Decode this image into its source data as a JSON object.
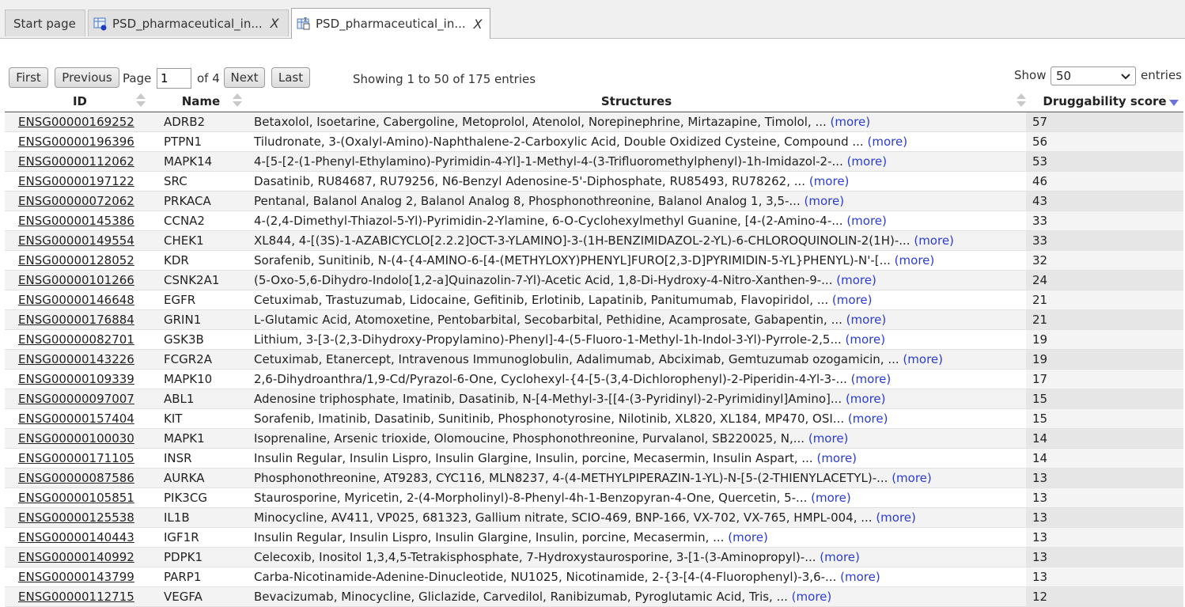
{
  "tabs": [
    {
      "label": "Start page"
    },
    {
      "label": "PSD_pharmaceutical_in...",
      "close": "X"
    },
    {
      "label": "PSD_pharmaceutical_in...",
      "close": "X"
    }
  ],
  "pager": {
    "first": "First",
    "previous": "Previous",
    "page_label": "Page",
    "page_value": "1",
    "of_label": "of 4",
    "next": "Next",
    "last": "Last",
    "info": "Showing 1 to 50 of 175 entries",
    "show_label": "Show",
    "show_value": "50",
    "entries_label": "entries"
  },
  "table": {
    "headers": {
      "id": "ID",
      "name": "Name",
      "structures": "Structures",
      "score": "Druggability score"
    },
    "more_label": "(more)",
    "rows": [
      {
        "id": "ENSG00000169252",
        "name": "ADRB2",
        "structures": "Betaxolol, Isoetarine, Cabergoline, Metoprolol, Atenolol, Norepinephrine, Mirtazapine, Timolol, ...",
        "score": "57"
      },
      {
        "id": "ENSG00000196396",
        "name": "PTPN1",
        "structures": "Tiludronate, 3-(Oxalyl-Amino)-Naphthalene-2-Carboxylic Acid, Double Oxidized Cysteine, Compound ...",
        "score": "56"
      },
      {
        "id": "ENSG00000112062",
        "name": "MAPK14",
        "structures": "4-[5-[2-(1-Phenyl-Ethylamino)-Pyrimidin-4-Yl]-1-Methyl-4-(3-Trifluoromethylphenyl)-1h-Imidazol-2-...",
        "score": "53"
      },
      {
        "id": "ENSG00000197122",
        "name": "SRC",
        "structures": "Dasatinib, RU84687, RU79256, N6-Benzyl Adenosine-5'-Diphosphate, RU85493, RU78262, ...",
        "score": "46"
      },
      {
        "id": "ENSG00000072062",
        "name": "PRKACA",
        "structures": "Pentanal, Balanol Analog 2, Balanol Analog 8, Phosphonothreonine, Balanol Analog 1, 3,5-...",
        "score": "43"
      },
      {
        "id": "ENSG00000145386",
        "name": "CCNA2",
        "structures": "4-(2,4-Dimethyl-Thiazol-5-Yl)-Pyrimidin-2-Ylamine, 6-O-Cyclohexylmethyl Guanine, [4-(2-Amino-4-...",
        "score": "33"
      },
      {
        "id": "ENSG00000149554",
        "name": "CHEK1",
        "structures": "XL844, 4-[(3S)-1-AZABICYCLO[2.2.2]OCT-3-YLAMINO]-3-(1H-BENZIMIDAZOL-2-YL)-6-CHLOROQUINOLIN-2(1H)-...",
        "score": "33"
      },
      {
        "id": "ENSG00000128052",
        "name": "KDR",
        "structures": "Sorafenib, Sunitinib, N-(4-{4-AMINO-6-[4-(METHYLOXY)PHENYL]FURO[2,3-D]PYRIMIDIN-5-YL}PHENYL)-N'-[...",
        "score": "32"
      },
      {
        "id": "ENSG00000101266",
        "name": "CSNK2A1",
        "structures": "(5-Oxo-5,6-Dihydro-Indolo[1,2-a]Quinazolin-7-Yl)-Acetic Acid, 1,8-Di-Hydroxy-4-Nitro-Xanthen-9-...",
        "score": "24"
      },
      {
        "id": "ENSG00000146648",
        "name": "EGFR",
        "structures": "Cetuximab, Trastuzumab, Lidocaine, Gefitinib, Erlotinib, Lapatinib, Panitumumab, Flavopiridol, ...",
        "score": "21"
      },
      {
        "id": "ENSG00000176884",
        "name": "GRIN1",
        "structures": "L-Glutamic Acid, Atomoxetine, Pentobarbital, Secobarbital, Pethidine, Acamprosate, Gabapentin, ...",
        "score": "21"
      },
      {
        "id": "ENSG00000082701",
        "name": "GSK3B",
        "structures": "Lithium, 3-[3-(2,3-Dihydroxy-Propylamino)-Phenyl]-4-(5-Fluoro-1-Methyl-1h-Indol-3-Yl)-Pyrrole-2,5...",
        "score": "19"
      },
      {
        "id": "ENSG00000143226",
        "name": "FCGR2A",
        "structures": "Cetuximab, Etanercept, Intravenous Immunoglobulin, Adalimumab, Abciximab, Gemtuzumab ozogamicin, ...",
        "score": "19"
      },
      {
        "id": "ENSG00000109339",
        "name": "MAPK10",
        "structures": "2,6-Dihydroanthra/1,9-Cd/Pyrazol-6-One, Cyclohexyl-{4-[5-(3,4-Dichlorophenyl)-2-Piperidin-4-Yl-3-...",
        "score": "17"
      },
      {
        "id": "ENSG00000097007",
        "name": "ABL1",
        "structures": "Adenosine triphosphate, Imatinib, Dasatinib, N-[4-Methyl-3-[[4-(3-Pyridinyl)-2-Pyrimidinyl]Amino]...",
        "score": "15"
      },
      {
        "id": "ENSG00000157404",
        "name": "KIT",
        "structures": "Sorafenib, Imatinib, Dasatinib, Sunitinib, Phosphonotyrosine, Nilotinib, XL820, XL184, MP470, OSI...",
        "score": "15"
      },
      {
        "id": "ENSG00000100030",
        "name": "MAPK1",
        "structures": "Isoprenaline, Arsenic trioxide, Olomoucine, Phosphonothreonine, Purvalanol, SB220025, N,...",
        "score": "14"
      },
      {
        "id": "ENSG00000171105",
        "name": "INSR",
        "structures": "Insulin Regular, Insulin Lispro, Insulin Glargine, Insulin, porcine, Mecasermin, Insulin Aspart, ...",
        "score": "14"
      },
      {
        "id": "ENSG00000087586",
        "name": "AURKA",
        "structures": "Phosphonothreonine, AT9283, CYC116, MLN8237, 4-(4-METHYLPIPERAZIN-1-YL)-N-[5-(2-THIENYLACETYL)-...",
        "score": "13"
      },
      {
        "id": "ENSG00000105851",
        "name": "PIK3CG",
        "structures": "Staurosporine, Myricetin, 2-(4-Morpholinyl)-8-Phenyl-4h-1-Benzopyran-4-One, Quercetin, 5-...",
        "score": "13"
      },
      {
        "id": "ENSG00000125538",
        "name": "IL1B",
        "structures": "Minocycline, AV411, VP025, 681323, Gallium nitrate, SCIO-469, BNP-166, VX-702, VX-765, HMPL-004, ...",
        "score": "13"
      },
      {
        "id": "ENSG00000140443",
        "name": "IGF1R",
        "structures": "Insulin Regular, Insulin Lispro, Insulin Glargine, Insulin, porcine, Mecasermin, ...",
        "score": "13"
      },
      {
        "id": "ENSG00000140992",
        "name": "PDPK1",
        "structures": "Celecoxib, Inositol 1,3,4,5-Tetrakisphosphate, 7-Hydroxystaurosporine, 3-[1-(3-Aminopropyl)-...",
        "score": "13"
      },
      {
        "id": "ENSG00000143799",
        "name": "PARP1",
        "structures": "Carba-Nicotinamide-Adenine-Dinucleotide, NU1025, Nicotinamide, 2-{3-[4-(4-Fluorophenyl)-3,6-...",
        "score": "13"
      },
      {
        "id": "ENSG00000112715",
        "name": "VEGFA",
        "structures": "Bevacizumab, Minocycline, Gliclazide, Carvedilol, Ranibizumab, Pyroglutamic Acid, Tris, ...",
        "score": "12"
      }
    ]
  }
}
